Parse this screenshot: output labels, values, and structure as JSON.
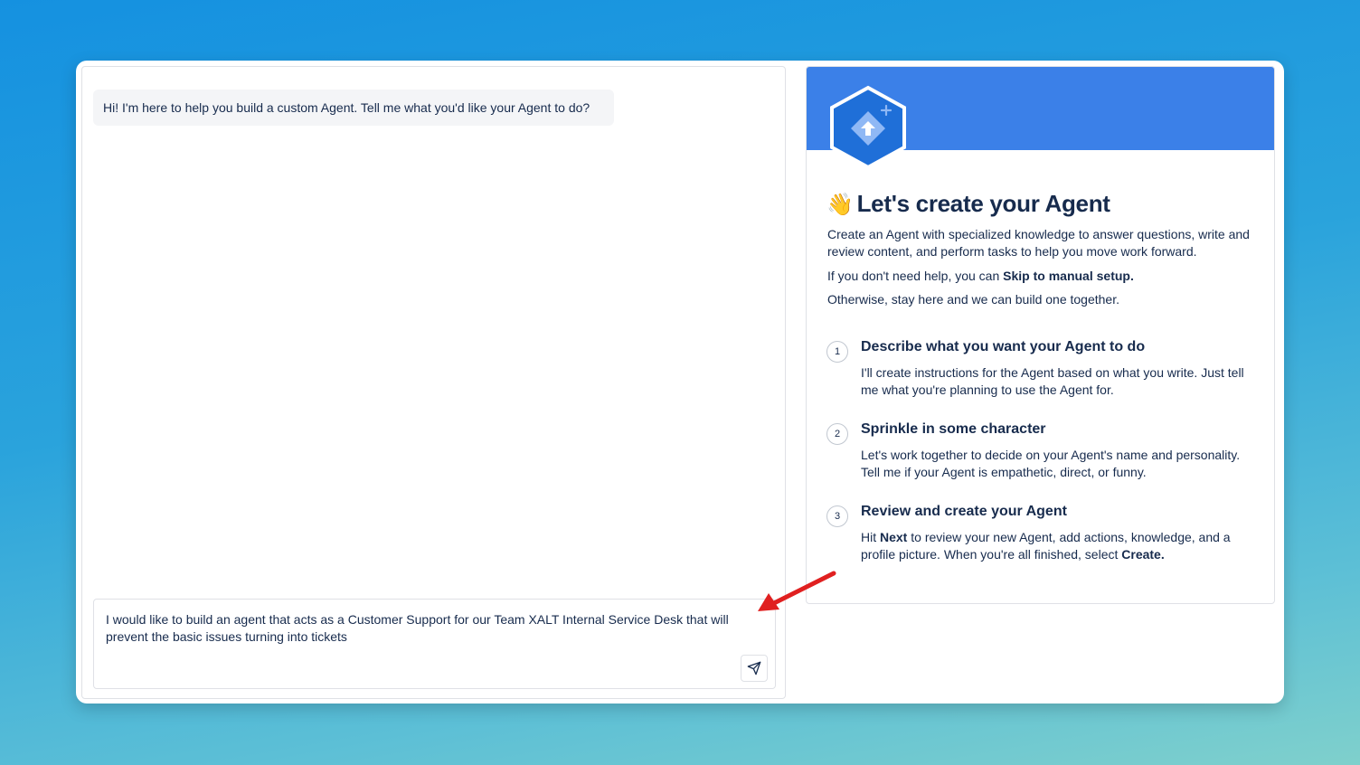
{
  "chat": {
    "bot_message": "Hi! I'm here to help you build a custom Agent. Tell me what you'd like your Agent to do?",
    "input_value": "I would like to build an agent that acts as a Customer Support for our Team XALT Internal Service Desk that will prevent the basic issues turning into tickets",
    "send_icon": "send-icon"
  },
  "info": {
    "title_emoji": "👋",
    "title": "Let's create your Agent",
    "intro": "Create an Agent with specialized knowledge to answer questions, write and review content, and perform tasks to help you move work forward.",
    "skip_prefix": "If you don't need help, you can ",
    "skip_link": "Skip to manual setup.",
    "otherwise": "Otherwise, stay here and we can build one together.",
    "steps": [
      {
        "num": "1",
        "title": "Describe what you want your Agent to do",
        "desc": "I'll create instructions for the Agent based on what you write. Just tell me what you're planning to use the Agent for."
      },
      {
        "num": "2",
        "title": "Sprinkle in some character",
        "desc": "Let's work together to decide on your Agent's name and personality. Tell me if your Agent is empathetic, direct, or funny."
      },
      {
        "num": "3",
        "title": "Review and create your Agent",
        "desc_1": "Hit ",
        "desc_next": "Next",
        "desc_2": " to review your new Agent, add actions, knowledge, and a profile picture. When you're all finished, select ",
        "desc_create": "Create."
      }
    ]
  },
  "colors": {
    "banner": "#3b80e8",
    "annotation_arrow": "#e02020"
  }
}
